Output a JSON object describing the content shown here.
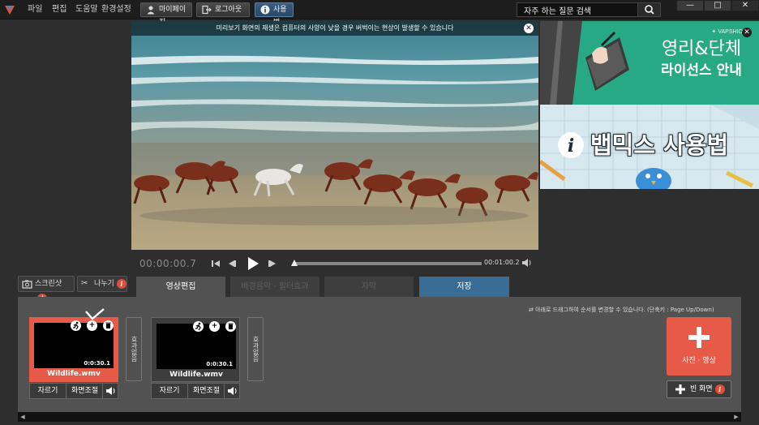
{
  "menu": [
    "파일",
    "편집",
    "도움말",
    "환경설정"
  ],
  "header_buttons": {
    "mypage": "마이페이지",
    "logout": "로그아웃",
    "howto": "사용법"
  },
  "search": {
    "value": "자주 하는 질문 검색"
  },
  "window": {
    "minimize": "—",
    "maximize": "□",
    "close": "✕"
  },
  "preview": {
    "notice": "미리보기 화면의 재생은 컴퓨터의 사양이 낮을 경우 버벅이는 현상이 발생할 수 있습니다",
    "timecode": "00:00:00.7",
    "duration": "00:01:00.2",
    "progress": 0.01
  },
  "ads": {
    "ad1": {
      "brand": "VAPSHION",
      "line1": "영리&단체",
      "line2": "라이선스 안내"
    },
    "ad2": {
      "title": "뱁믹스 사용법"
    }
  },
  "tools": {
    "screenshot": "스크린샷",
    "split": "나누기"
  },
  "tabs": [
    "영상편집",
    "배경음악 · 필터효과",
    "자막",
    "저장"
  ],
  "hint": "아래로 드래그하여 순서를 변경할 수 있습니다. (단축키 : Page Up/Down)",
  "clips": [
    {
      "name": "Wildlife.wmv",
      "timecode": "0:0:30.1",
      "cut": "자르기",
      "adjust": "화면조절",
      "selected": true
    },
    {
      "name": "Wildlife.wmv",
      "timecode": "0:0:30.1",
      "cut": "자르기",
      "adjust": "화면조절",
      "selected": false
    }
  ],
  "effect_label": "효과없음",
  "add_button": {
    "label": "사진 · 영상"
  },
  "blank_button": {
    "label": "빈 화면"
  },
  "colors": {
    "accent_red": "#e85a48",
    "save_blue": "#3a6d96",
    "ad_green": "#28a986"
  }
}
